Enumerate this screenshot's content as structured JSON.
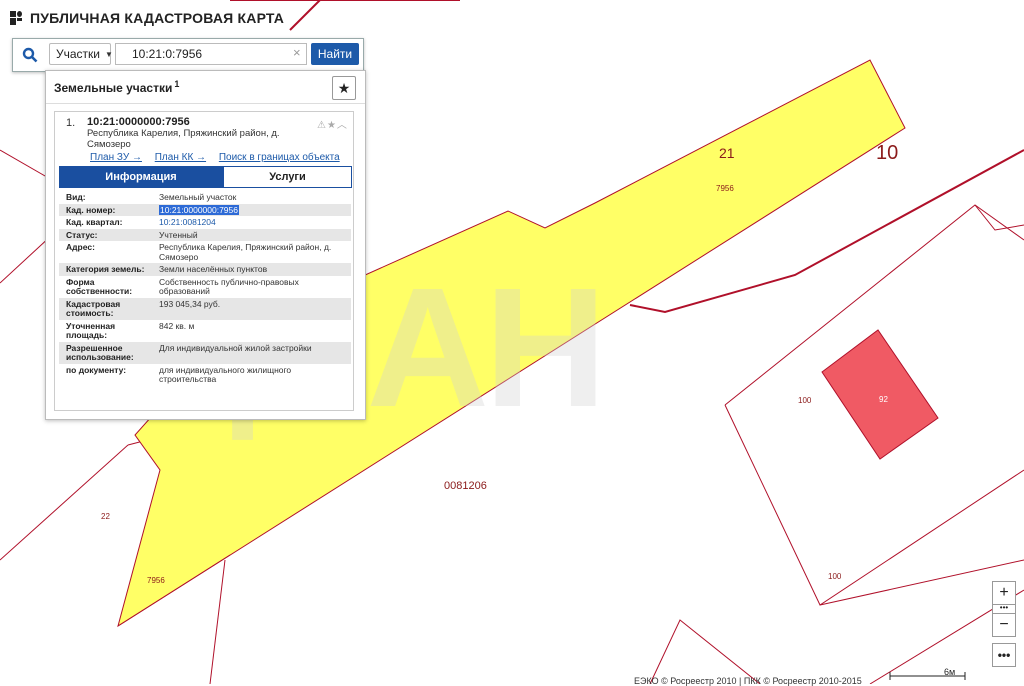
{
  "header": {
    "title": "ПУБЛИЧНАЯ КАДАСТРОВАЯ КАРТА"
  },
  "search": {
    "mode_label": "Участки",
    "query": "10:21:0:7956",
    "clear_icon": "×",
    "find_label": "Найти"
  },
  "panel": {
    "title": "Земельные участки",
    "count": "1",
    "item": {
      "index": "1.",
      "cadastral_number": "10:21:0000000:7956",
      "address": "Республика Карелия, Пряжинский район, д. Сямозеро",
      "links": [
        "План ЗУ →",
        "План КК →",
        "Поиск в границах объекта →"
      ],
      "tabs": {
        "info": "Информация",
        "services": "Услуги"
      },
      "attributes": [
        {
          "key": "Вид:",
          "value": "Земельный участок"
        },
        {
          "key": "Кад. номер:",
          "value": "10:21:0000000:7956"
        },
        {
          "key": "Кад. квартал:",
          "value": "10:21:0081204"
        },
        {
          "key": "Статус:",
          "value": "Учтенный"
        },
        {
          "key": "Адрес:",
          "value": "Республика Карелия, Пряжинский район, д. Сямозеро"
        },
        {
          "key": "Категория земель:",
          "value": "Земли населённых пунктов"
        },
        {
          "key": "Форма собственности:",
          "value": "Собственность публично-правовых образований"
        },
        {
          "key": "Кадастровая стоимость:",
          "value": "193 045,34 руб."
        },
        {
          "key": "Уточненная площадь:",
          "value": "842 кв. м"
        },
        {
          "key": "Разрешенное использование:",
          "value": "Для индивидуальной жилой застройки"
        },
        {
          "key": "по документу:",
          "value": "для индивидуального жилищного строительства"
        }
      ]
    }
  },
  "map": {
    "labels": {
      "district": "10",
      "block_21": "21",
      "parcel_top": "7956",
      "parcel_bottom": "7956",
      "quarter": "0081206",
      "lot_22": "22",
      "lot_100_a": "100",
      "lot_100_b": "100",
      "building_92": "92"
    },
    "colors": {
      "parcel_fill": "#ffff66",
      "boundary": "#b0102a",
      "building": "#f05a64"
    }
  },
  "controls": {
    "zoom_in": "+",
    "zoom_out": "−",
    "more": "•••",
    "scale": "6м"
  },
  "footer": {
    "copyright": "ЕЭКО © Росреестр 2010 | ПКК © Росреестр 2010-2015"
  },
  "watermark": "ЦИАН"
}
